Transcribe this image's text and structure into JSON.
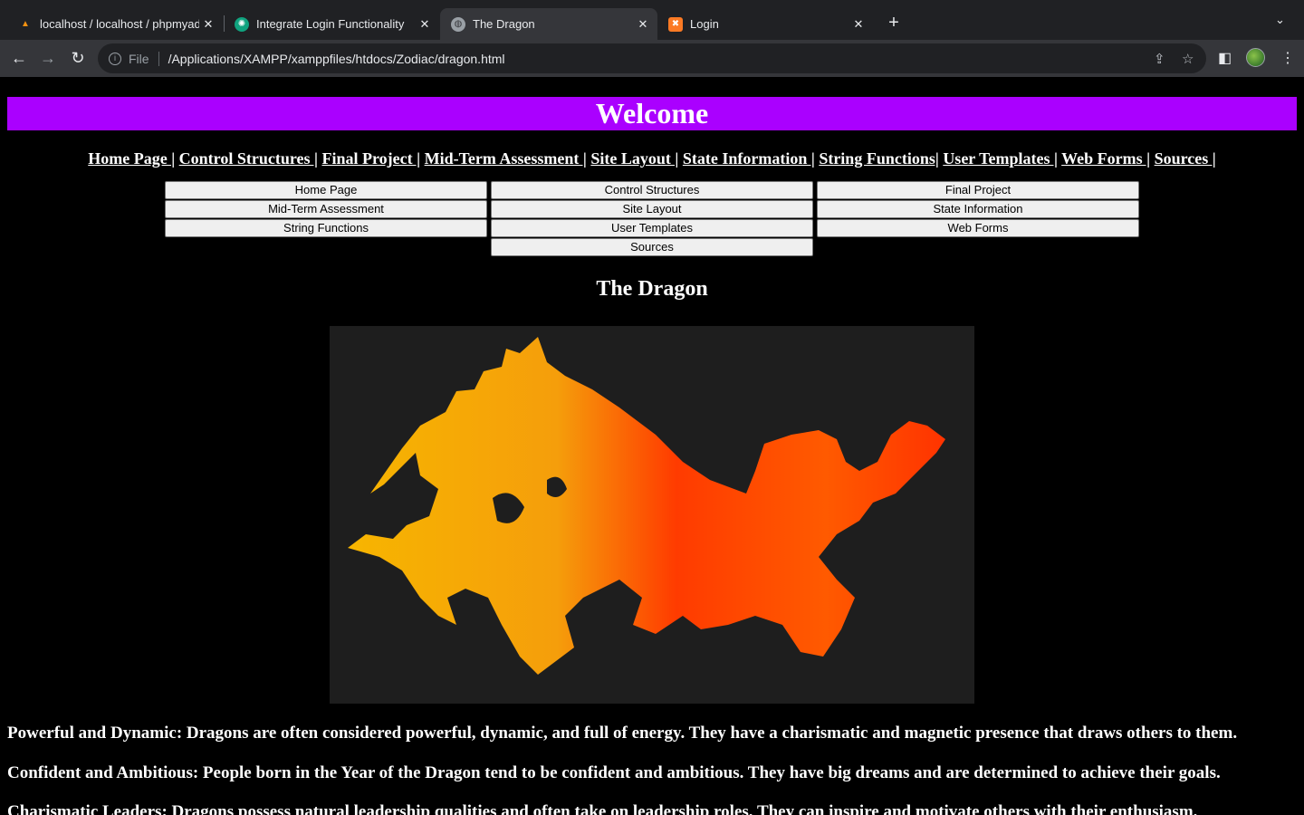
{
  "browser": {
    "tabs": [
      {
        "title": "localhost / localhost / phpmyadmin"
      },
      {
        "title": "Integrate Login Functionality"
      },
      {
        "title": "The Dragon"
      },
      {
        "title": "Login"
      }
    ],
    "address": {
      "scheme_label": "File",
      "url": "/Applications/XAMPP/xamppfiles/htdocs/Zodiac/dragon.html"
    }
  },
  "page": {
    "banner": "Welcome",
    "links": [
      "Home Page |",
      "Control Structures |",
      "Final Project |",
      "Mid-Term Assessment |",
      "Site Layout |",
      "State Information |",
      "String Functions|",
      "User Templates |",
      "Web Forms |",
      "Sources |"
    ],
    "buttons": [
      "Home Page",
      "Control Structures",
      "Final Project",
      "Mid-Term Assessment",
      "Site Layout",
      "State Information",
      "String Functions",
      "User Templates",
      "Web Forms",
      "Sources"
    ],
    "title": "The Dragon",
    "paragraphs": [
      "Powerful and Dynamic: Dragons are often considered powerful, dynamic, and full of energy. They have a charismatic and magnetic presence that draws others to them.",
      "Confident and Ambitious: People born in the Year of the Dragon tend to be confident and ambitious. They have big dreams and are determined to achieve their goals.",
      "Charismatic Leaders: Dragons possess natural leadership qualities and often take on leadership roles. They can inspire and motivate others with their enthusiasm."
    ]
  },
  "colors": {
    "banner_bg": "#aa00ff",
    "page_bg": "#000000"
  }
}
